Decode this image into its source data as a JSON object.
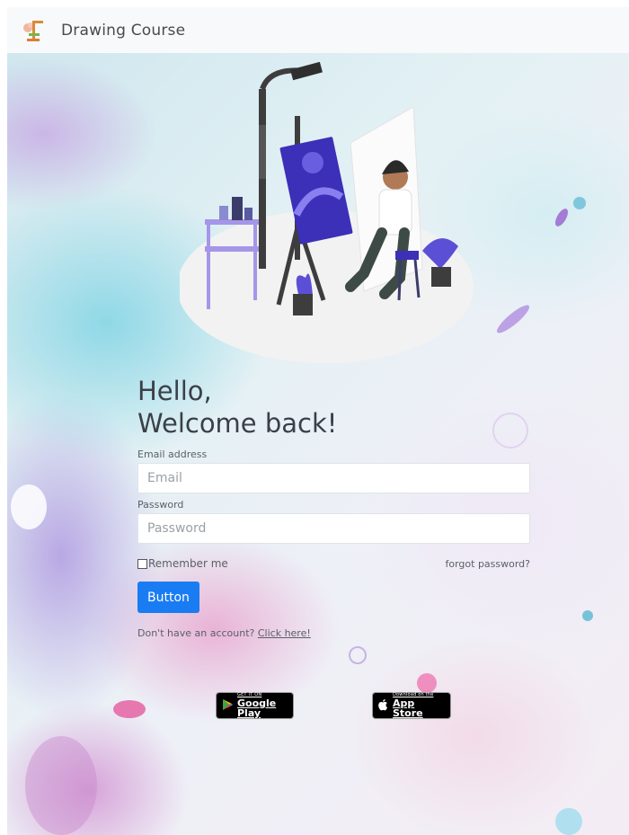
{
  "navbar": {
    "brand": "Drawing Course",
    "logo_icon": "easel-logo-icon"
  },
  "hero": {
    "illustration": "artist-painting-illustration"
  },
  "login": {
    "greeting_line1": "Hello,",
    "greeting_line2": "Welcome back!",
    "email_label": "Email address",
    "email_placeholder": "Email",
    "email_value": "",
    "password_label": "Password",
    "password_placeholder": "Password",
    "password_value": "",
    "remember_label": "Remember me",
    "remember_checked": false,
    "forgot_label": "forgot password?",
    "submit_label": "Button",
    "signup_prefix": "Don't have an account? ",
    "signup_link": "Click here!"
  },
  "stores": {
    "google_small": "GET IT ON",
    "google_big": "Google Play",
    "apple_small": "Download on the",
    "apple_big": "App Store"
  },
  "colors": {
    "primary": "#1a7cf2",
    "navbar_bg": "#f8f9fa",
    "text": "#3b3f47"
  }
}
